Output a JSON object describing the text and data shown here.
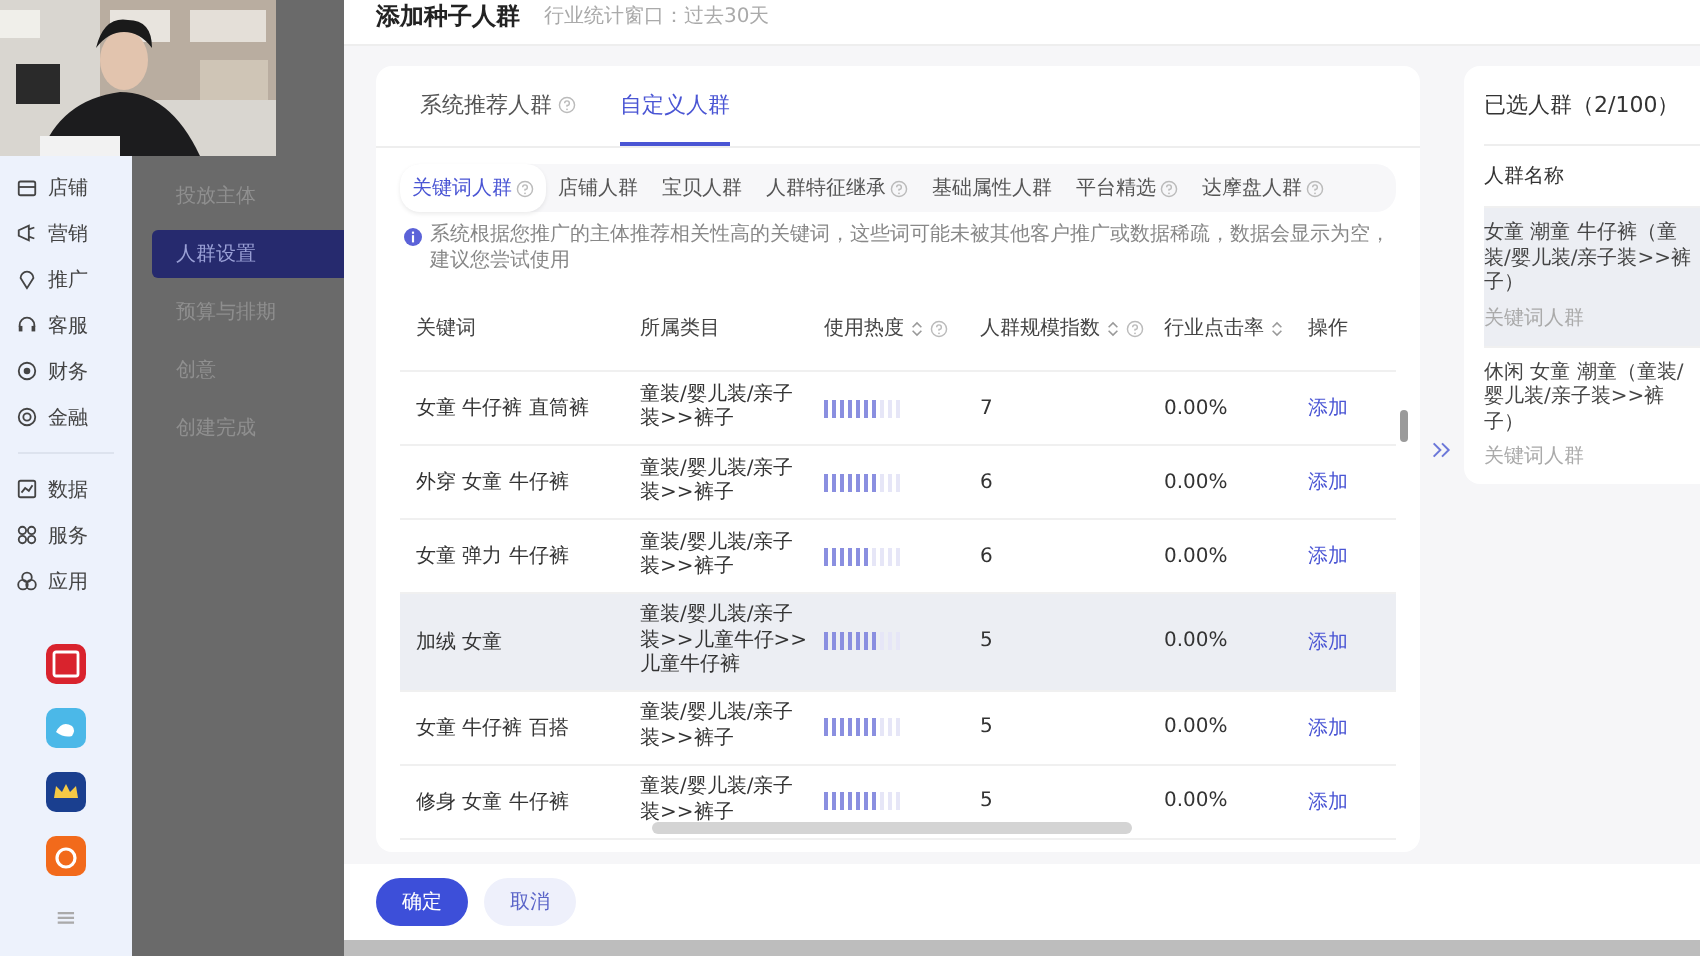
{
  "nav": {
    "groups": [
      [
        {
          "label": "店铺"
        },
        {
          "label": "营销"
        },
        {
          "label": "推广"
        },
        {
          "label": "客服"
        },
        {
          "label": "财务"
        },
        {
          "label": "金融"
        }
      ],
      [
        {
          "label": "数据"
        },
        {
          "label": "服务"
        },
        {
          "label": "应用"
        }
      ]
    ],
    "menu_icon": "≡"
  },
  "steps": [
    {
      "label": "投放主体",
      "selected": false
    },
    {
      "label": "人群设置",
      "selected": true
    },
    {
      "label": "预算与排期",
      "selected": false
    },
    {
      "label": "创意",
      "selected": false
    },
    {
      "label": "创建完成",
      "selected": false
    }
  ],
  "drawer": {
    "title": "添加种子人群",
    "subtitle": "行业统计窗口：过去30天"
  },
  "main_tabs": [
    {
      "label": "系统推荐人群",
      "help": true,
      "selected": false
    },
    {
      "label": "自定义人群",
      "help": false,
      "selected": true
    }
  ],
  "sub_tabs": [
    {
      "label": "关键词人群",
      "help": true,
      "selected": true
    },
    {
      "label": "店铺人群",
      "help": false,
      "selected": false
    },
    {
      "label": "宝贝人群",
      "help": false,
      "selected": false
    },
    {
      "label": "人群特征继承",
      "help": true,
      "selected": false
    },
    {
      "label": "基础属性人群",
      "help": false,
      "selected": false
    },
    {
      "label": "平台精选",
      "help": true,
      "selected": false
    },
    {
      "label": "达摩盘人群",
      "help": true,
      "selected": false
    }
  ],
  "notice": "系统根据您推广的主体推荐相关性高的关键词，这些词可能未被其他客户推广或数据稀疏，数据会显示为空，建议您尝试使用",
  "table": {
    "columns": [
      {
        "label": "关键词",
        "sortable": false,
        "help": false
      },
      {
        "label": "所属类目",
        "sortable": false,
        "help": false
      },
      {
        "label": "使用热度",
        "sortable": true,
        "help": true
      },
      {
        "label": "人群规模指数",
        "sortable": true,
        "help": true
      },
      {
        "label": "行业点击率",
        "sortable": true,
        "help": false
      },
      {
        "label": "操作",
        "sortable": false,
        "help": false
      }
    ],
    "rows": [
      {
        "keyword": "女童 牛仔裤 直筒裤",
        "category": "童装/婴儿装/亲子装>>裤子",
        "heat": {
          "level": 0.7
        },
        "scale": "7",
        "ctr": "0.00%",
        "action": "添加",
        "highlighted": false
      },
      {
        "keyword": "外穿 女童 牛仔裤",
        "category": "童装/婴儿装/亲子装>>裤子",
        "heat": {
          "level": 0.7
        },
        "scale": "6",
        "ctr": "0.00%",
        "action": "添加",
        "highlighted": false
      },
      {
        "keyword": "女童 弹力 牛仔裤",
        "category": "童装/婴儿装/亲子装>>裤子",
        "heat": {
          "level": 0.6
        },
        "scale": "6",
        "ctr": "0.00%",
        "action": "添加",
        "highlighted": false
      },
      {
        "keyword": "加绒 女童",
        "category": "童装/婴儿装/亲子装>>儿童牛仔>>儿童牛仔裤",
        "heat": {
          "level": 0.7
        },
        "scale": "5",
        "ctr": "0.00%",
        "action": "添加",
        "highlighted": true
      },
      {
        "keyword": "女童 牛仔裤 百搭",
        "category": "童装/婴儿装/亲子装>>裤子",
        "heat": {
          "level": 0.7
        },
        "scale": "5",
        "ctr": "0.00%",
        "action": "添加",
        "highlighted": false
      },
      {
        "keyword": "修身 女童 牛仔裤",
        "category": "童装/婴儿装/亲子装>>裤子",
        "heat": {
          "level": 0.7
        },
        "scale": "5",
        "ctr": "0.00%",
        "action": "添加",
        "highlighted": false
      }
    ]
  },
  "selected_panel": {
    "title": "已选人群（2/100）",
    "column": "人群名称",
    "items": [
      {
        "name": "女童 潮童 牛仔裤（童装/婴儿装/亲子装>>裤子）",
        "type": "关键词人群",
        "highlighted": true
      },
      {
        "name": "休闲 女童 潮童（童装/婴儿装/亲子装>>裤子）",
        "type": "关键词人群",
        "highlighted": false
      }
    ]
  },
  "footer": {
    "buttons": [
      {
        "label": "确定",
        "kind": "primary"
      },
      {
        "label": "取消",
        "kind": "secondary"
      }
    ]
  }
}
